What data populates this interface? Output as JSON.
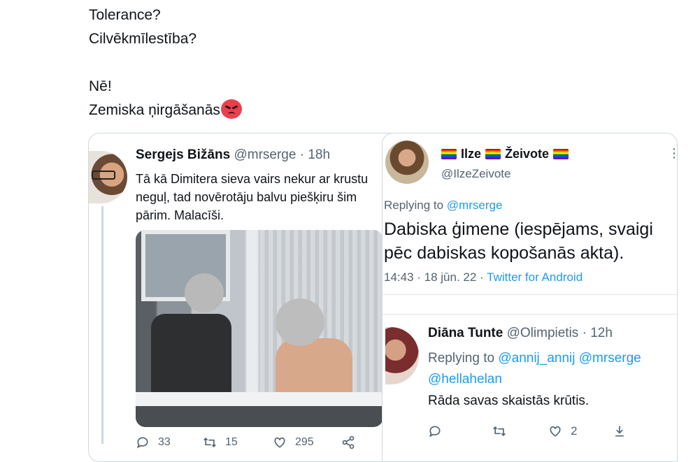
{
  "post": {
    "lines": [
      "Tolerance?",
      "Cilvēkmīlestība?",
      "",
      "Nē!",
      "Zemiska ņirgāšanās"
    ],
    "emoji_icon": "angry-face-emoji"
  },
  "tweet_left": {
    "name": "Sergejs Bižāns",
    "handle": "@mrserge",
    "time": "· 18h",
    "text": "Tā kā Dimitera sieva vairs nekur ar krustu neguļ, tad novērotāju balvu piešķiru šim pārim. Malacīši.",
    "replies": "33",
    "retweets": "15",
    "likes": "295"
  },
  "tweet_right": {
    "name": "Ilze",
    "name_last": "Žeivote",
    "handle": "@IlzeZeivote",
    "replying_label": "Replying to",
    "replying_to": "@mrserge",
    "text_line1": "Dabiska ģimene (iespējams, svaigi",
    "text_line2": "pēc dabiskas kopošanās akta).",
    "time": "14:43 · 18 jūn. 22 ·",
    "source": "Twitter for Android"
  },
  "reply": {
    "name": "Diāna Tunte",
    "handle": "@Olimpietis",
    "time": "· 12h",
    "replying_label": "Replying to",
    "replying_to_1": "@annij_annij @mrserge",
    "replying_to_2": "@hellahelan",
    "text": "Rāda savas skaistās krūtis.",
    "likes": "2"
  }
}
